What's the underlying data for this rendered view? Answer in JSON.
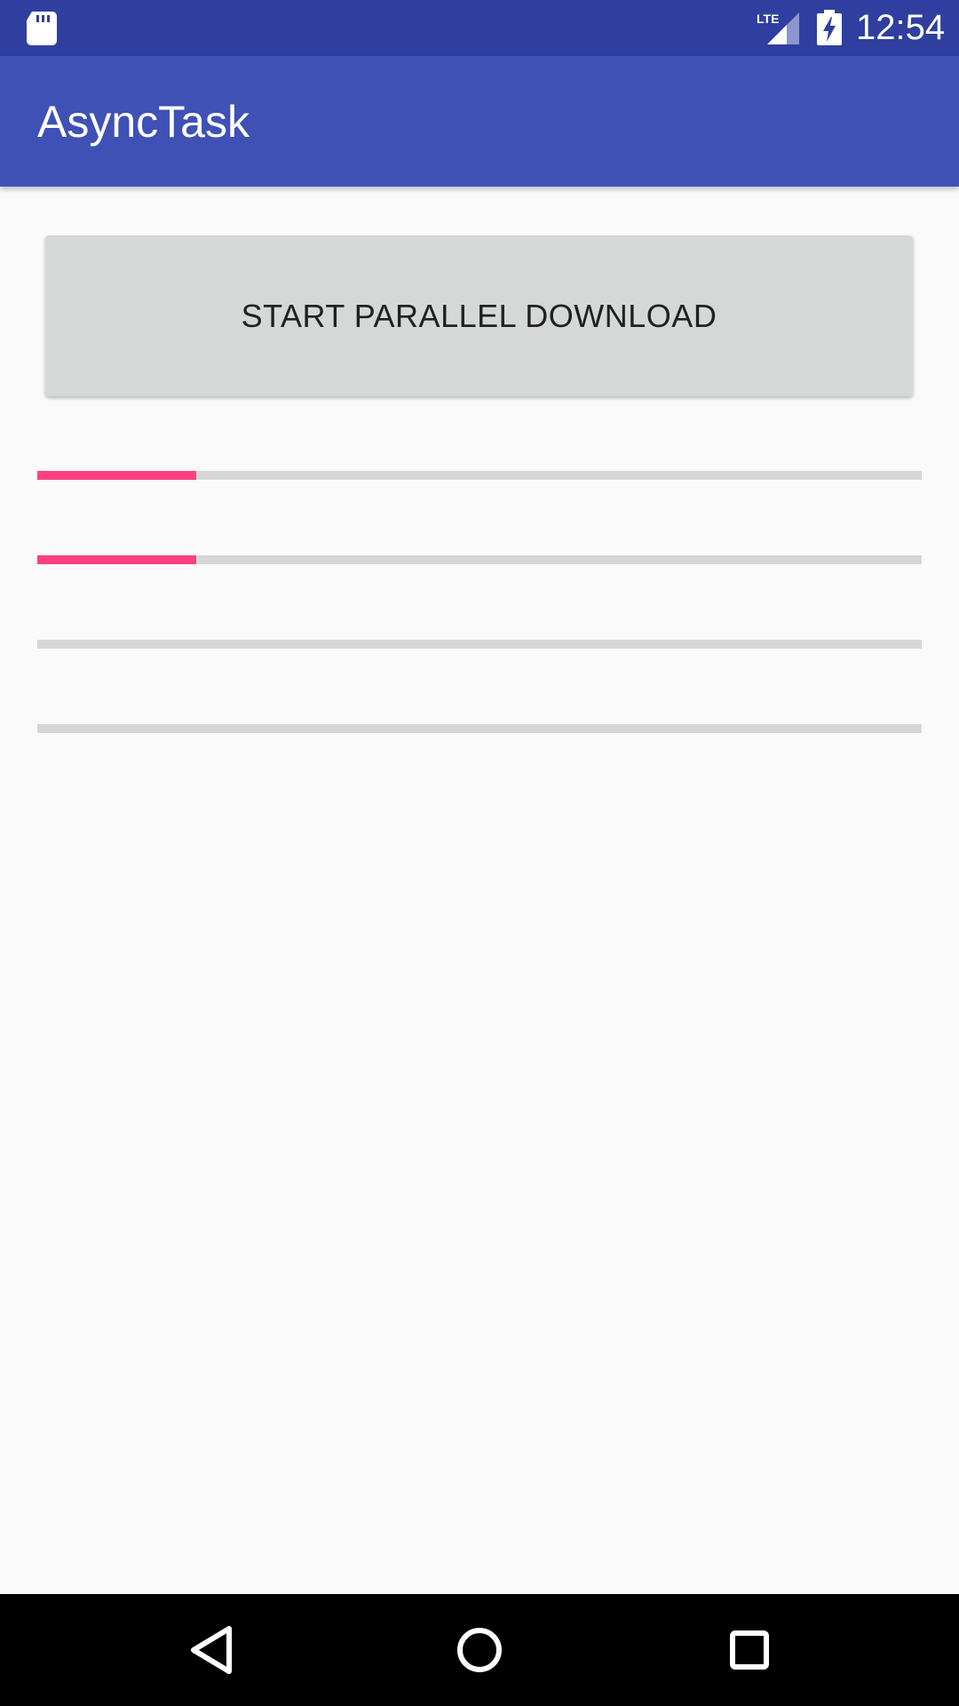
{
  "status_bar": {
    "time": "12:54",
    "network": "LTE",
    "icons": [
      "sd-card-icon",
      "lte-signal-icon",
      "battery-charging-icon"
    ]
  },
  "app_bar": {
    "title": "AsyncTask",
    "color": "#3f51b5"
  },
  "main": {
    "start_button_label": "START PARALLEL DOWNLOAD",
    "progress_bars": [
      {
        "progress": 0.18
      },
      {
        "progress": 0.18
      },
      {
        "progress": 0.0
      },
      {
        "progress": 0.0
      }
    ],
    "accent_color": "#ff4081"
  },
  "nav_bar": {
    "icons": [
      "back-icon",
      "home-icon",
      "recents-icon"
    ]
  }
}
